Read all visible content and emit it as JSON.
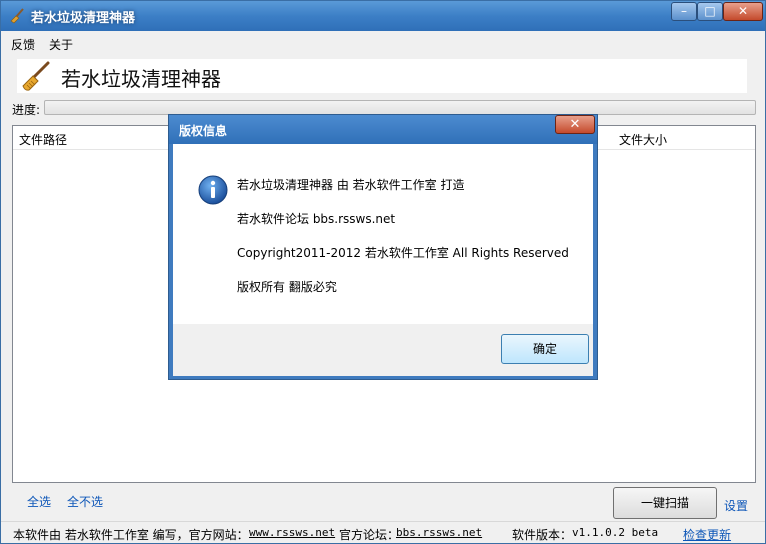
{
  "window": {
    "title": "若水垃圾清理神器",
    "menu": {
      "feedback": "反馈",
      "about": "关于"
    },
    "banner_title": "若水垃圾清理神器",
    "progress_label": "进度:",
    "progress_value": 0,
    "columns": {
      "path": "文件路径",
      "size": "文件大小"
    },
    "select_all": "全选",
    "select_none": "全不选",
    "scan_button": "一键扫描",
    "settings": "设置"
  },
  "statusbar": {
    "made_by": "本软件由 若水软件工作室 编写，官方网站：",
    "site": "www.rssws.net",
    "forum_label": "官方论坛：",
    "forum": "bbs.rssws.net",
    "version_label": "软件版本：",
    "version": "v1.1.0.2 beta",
    "update": "检查更新"
  },
  "dialog": {
    "title": "版权信息",
    "lines": [
      "若水垃圾清理神器 由 若水软件工作室 打造",
      "若水软件论坛   bbs.rssws.net",
      "Copyright2011-2012 若水软件工作室 All Rights Reserved",
      "版权所有 翻版必究"
    ],
    "ok": "确定"
  },
  "colors": {
    "title_bar": "#3c7fc6",
    "link": "#0d56b8",
    "close_red": "#c44a2c",
    "progress_fill": "#37b037"
  },
  "icons": {
    "app": "broom-icon",
    "info": "info-icon"
  }
}
